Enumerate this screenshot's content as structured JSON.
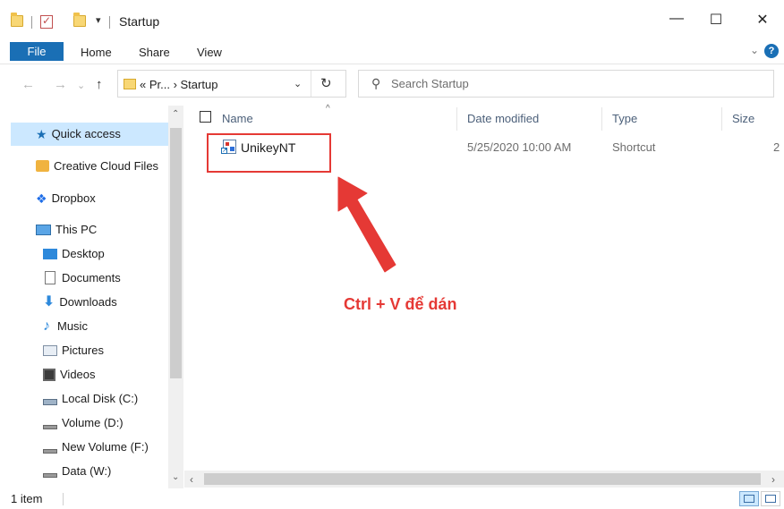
{
  "window": {
    "title": "Startup",
    "quick_access_dropdown": "▾",
    "minimize": "—",
    "maximize": "☐",
    "close": "✕"
  },
  "ribbon": {
    "tabs": [
      "File",
      "Home",
      "Share",
      "View"
    ],
    "expand_chevron": "⌄",
    "help": "?"
  },
  "nav": {
    "back": "←",
    "forward": "→",
    "recent": "⌄",
    "up": "↑"
  },
  "address": {
    "path": "« Pr... › Startup",
    "dropdown": "⌄",
    "refresh": "↻"
  },
  "search": {
    "placeholder": "Search Startup"
  },
  "sidebar": {
    "items": [
      {
        "label": "Quick access",
        "icon": "star-icon",
        "selected": true
      },
      {
        "label": "Creative Cloud Files",
        "icon": "creative-cloud-icon"
      },
      {
        "label": "Dropbox",
        "icon": "dropbox-icon"
      },
      {
        "label": "This PC",
        "icon": "computer-icon"
      },
      {
        "label": "Desktop",
        "icon": "desktop-icon"
      },
      {
        "label": "Documents",
        "icon": "documents-icon"
      },
      {
        "label": "Downloads",
        "icon": "downloads-icon"
      },
      {
        "label": "Music",
        "icon": "music-icon"
      },
      {
        "label": "Pictures",
        "icon": "pictures-icon"
      },
      {
        "label": "Videos",
        "icon": "videos-icon"
      },
      {
        "label": "Local Disk (C:)",
        "icon": "local-disk-icon"
      },
      {
        "label": "Volume (D:)",
        "icon": "drive-icon"
      },
      {
        "label": "New Volume (F:)",
        "icon": "drive-icon"
      },
      {
        "label": "Data (W:)",
        "icon": "drive-icon"
      }
    ]
  },
  "list": {
    "columns": [
      "Name",
      "Date modified",
      "Type",
      "Size"
    ],
    "files": [
      {
        "name": "UnikeyNT",
        "date_modified": "5/25/2020 10:00 AM",
        "type": "Shortcut",
        "size": "2"
      }
    ]
  },
  "annotation": {
    "text": "Ctrl + V để dán",
    "color": "#e53935"
  },
  "status": {
    "item_count": "1 item"
  },
  "colors": {
    "accent": "#1a6fb5",
    "selection": "#cce8ff",
    "header_text": "#4c607a"
  }
}
